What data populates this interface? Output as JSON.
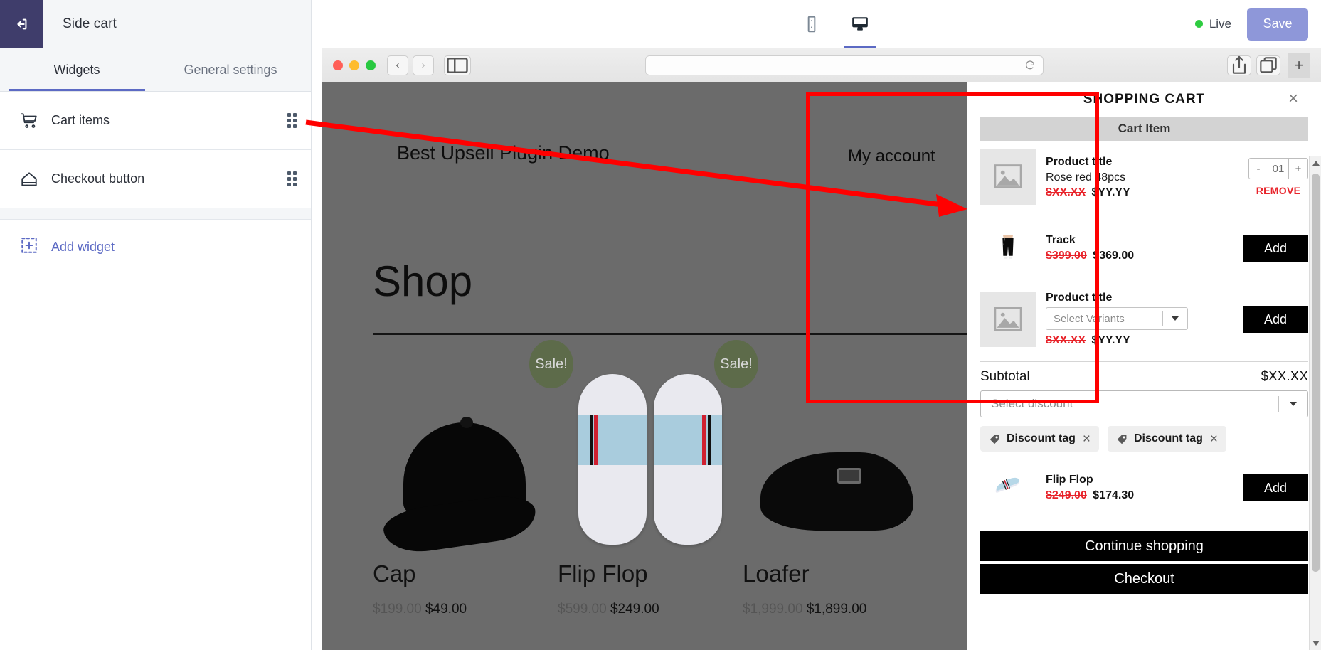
{
  "left_panel": {
    "back_icon": "back-arrow-icon",
    "title": "Side cart",
    "tabs": [
      {
        "label": "Widgets",
        "active": true
      },
      {
        "label": "General settings",
        "active": false
      }
    ],
    "widgets": [
      {
        "label": "Cart items",
        "icon": "cart-icon"
      },
      {
        "label": "Checkout button",
        "icon": "checkout-icon"
      }
    ],
    "add_widget": {
      "label": "Add widget",
      "icon": "add-widget-icon"
    }
  },
  "topbar": {
    "devices": [
      {
        "name": "mobile-view",
        "active": false
      },
      {
        "name": "desktop-view",
        "active": true
      }
    ],
    "live_label": "Live",
    "live_color": "#2ecc40",
    "save_label": "Save",
    "save_color": "#8e97d9"
  },
  "browser": {
    "traffic_lights": [
      "close",
      "minimize",
      "zoom"
    ],
    "back_glyph": "‹",
    "forward_glyph": "›",
    "sidebar_icon": "sidebar-toggle-icon",
    "address_value": "",
    "address_placeholder": "",
    "reload_icon": "reload-icon",
    "share_icon": "share-icon",
    "tabs_icon": "tab-overview-icon",
    "new_tab_glyph": "+"
  },
  "store_page": {
    "brand": "Best Upsell Plugin Demo",
    "account_link": "My account",
    "heading": "Shop",
    "products": [
      {
        "name": "Cap",
        "old_price": "$199.00",
        "price": "$49.00",
        "badge": "Sale!",
        "art": "cap"
      },
      {
        "name": "Flip Flop",
        "old_price": "$599.00",
        "price": "$249.00",
        "badge": "Sale!",
        "art": "flops"
      },
      {
        "name": "Loafer",
        "old_price": "$1,999.00",
        "price": "$1,899.00",
        "badge": "",
        "art": "loafer"
      }
    ]
  },
  "side_cart": {
    "title": "SHOPPING CART",
    "close_glyph": "×",
    "cart_item_header": "Cart Item",
    "items": [
      {
        "title": "Product title",
        "variant": "Rose red 48pcs",
        "old_price": "$XX.XX",
        "price": "$YY.YY",
        "qty_minus": "-",
        "qty_value": "01",
        "qty_plus": "+",
        "remove_label": "REMOVE",
        "thumb": "placeholder-image-icon"
      },
      {
        "title": "Track",
        "old_price": "$399.00",
        "price": "$369.00",
        "add_label": "Add",
        "thumb": "track-pants-photo"
      },
      {
        "title": "Product title",
        "variant_placeholder": "Select Variants",
        "old_price": "$XX.XX",
        "price": "$YY.YY",
        "add_label": "Add",
        "thumb": "placeholder-image-icon"
      }
    ],
    "subtotal_label": "Subtotal",
    "subtotal_value": "$XX.XX",
    "discount_placeholder": "Select discount",
    "discount_tags": [
      {
        "label": "Discount tag",
        "remove_glyph": "×"
      },
      {
        "label": "Discount tag",
        "remove_glyph": "×"
      }
    ],
    "upsell": {
      "title": "Flip Flop",
      "old_price": "$249.00",
      "price": "$174.30",
      "add_label": "Add",
      "thumb": "flip-flop-photo"
    },
    "continue_label": "Continue shopping",
    "checkout_label": "Checkout",
    "highlight_color": "#ff0000"
  }
}
